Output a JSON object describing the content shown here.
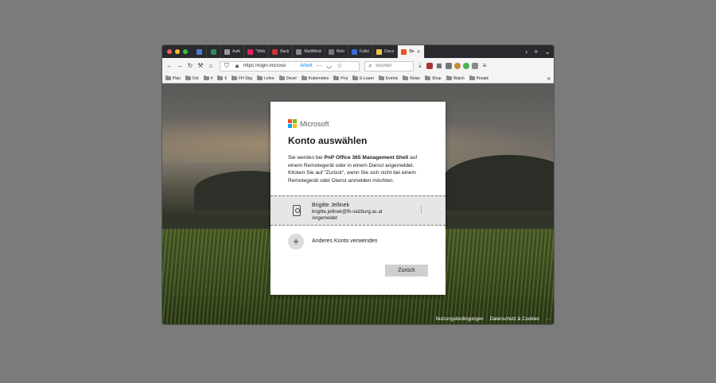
{
  "browser": {
    "tabs": [
      {
        "label": "",
        "color": "#4a7bd0",
        "pinned": true
      },
      {
        "label": "",
        "color": "#2e8b57",
        "pinned": true
      },
      {
        "label": "Auth",
        "color": "#999999"
      },
      {
        "label": "\"Web",
        "color": "#e0245e"
      },
      {
        "label": "Back",
        "color": "#cc3333"
      },
      {
        "label": "MultiMedi",
        "color": "#888888"
      },
      {
        "label": "Web",
        "color": "#777777"
      },
      {
        "label": "Fullst",
        "color": "#3b6bd6"
      },
      {
        "label": "Disco",
        "color": "#e8c14b"
      },
      {
        "label": "Be",
        "color": "#f25022",
        "active": true
      }
    ],
    "url": "https://login.microso",
    "container_label": "Arbeit",
    "search_placeholder": "Suchen",
    "bookmarks": [
      "Plan",
      "Dol",
      "4",
      "€",
      "FH Sbg",
      "Lehre",
      "Devel",
      "Kubernetes",
      "Proj",
      "E-Learn",
      "Events",
      "Reise",
      "Shop",
      "Watch",
      "People"
    ]
  },
  "dialog": {
    "brand": "Microsoft",
    "title": "Konto auswählen",
    "desc_prefix": "Sie werden bei ",
    "desc_app": "PnP Office 365 Management Shell",
    "desc_suffix": " auf einem Remotegerät oder in einem Dienst angemeldet. Klicken Sie auf \"Zurück\", wenn Sie sich nicht bei einem Remotegerät oder Dienst anmelden möchten.",
    "account": {
      "name": "Brigitte Jellinek",
      "email": "brigitte.jellinek@fh-salzburg.ac.at",
      "status": "Angemeldet"
    },
    "add_account_label": "Anderes Konto verwenden",
    "back_button": "Zurück"
  },
  "footer": {
    "terms": "Nutzungsbedingungen",
    "privacy": "Datenschutz & Cookies",
    "more": "···"
  },
  "colors": {
    "ms_red": "#f25022",
    "ms_green": "#7fba00",
    "ms_blue": "#00a4ef",
    "ms_yellow": "#ffb900",
    "close_dot": "#ff5f57",
    "min_dot": "#febc2e",
    "max_dot": "#28c840"
  }
}
